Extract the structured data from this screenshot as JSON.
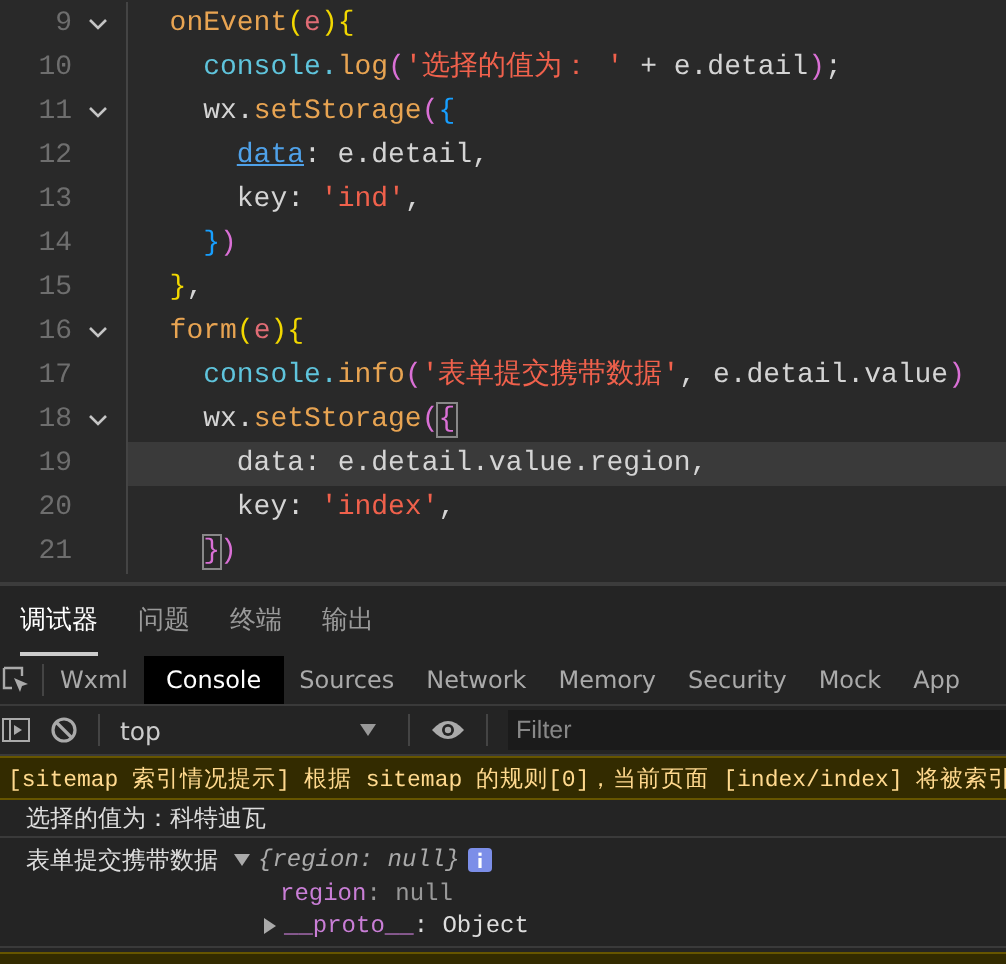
{
  "editor": {
    "lines": [
      {
        "number": "9",
        "foldable": true,
        "highlighted": false,
        "tokens": [
          {
            "text": "  onEvent",
            "kind": "fn"
          },
          {
            "text": "(",
            "kind": "br1"
          },
          {
            "text": "e",
            "kind": "param"
          },
          {
            "text": ")",
            "kind": "br1"
          },
          {
            "text": "{",
            "kind": "br1"
          }
        ]
      },
      {
        "number": "10",
        "foldable": false,
        "highlighted": false,
        "tokens": [
          {
            "text": "    console.",
            "kind": "obj"
          },
          {
            "text": "log",
            "kind": "fn"
          },
          {
            "text": "(",
            "kind": "br2"
          },
          {
            "text": "'选择的值为： '",
            "kind": "str"
          },
          {
            "text": " + e.detail",
            "kind": "txt"
          },
          {
            "text": ")",
            "kind": "br2"
          },
          {
            "text": ";",
            "kind": "txt"
          }
        ]
      },
      {
        "number": "11",
        "foldable": true,
        "highlighted": false,
        "tokens": [
          {
            "text": "    wx.",
            "kind": "txt"
          },
          {
            "text": "setStorage",
            "kind": "fn"
          },
          {
            "text": "(",
            "kind": "br2"
          },
          {
            "text": "{",
            "kind": "br3"
          }
        ]
      },
      {
        "number": "12",
        "foldable": false,
        "highlighted": false,
        "tokens": [
          {
            "text": "data",
            "kind": "link"
          },
          {
            "text": ": e.detail,",
            "kind": "txt"
          }
        ]
      },
      {
        "number": "13",
        "foldable": false,
        "highlighted": false,
        "tokens": [
          {
            "text": "      key: ",
            "kind": "txt"
          },
          {
            "text": "'ind'",
            "kind": "str"
          },
          {
            "text": ",",
            "kind": "txt"
          }
        ]
      },
      {
        "number": "14",
        "foldable": false,
        "highlighted": false,
        "tokens": [
          {
            "text": "    }",
            "kind": "br3"
          },
          {
            "text": ")",
            "kind": "br2"
          }
        ]
      },
      {
        "number": "15",
        "foldable": false,
        "highlighted": false,
        "tokens": [
          {
            "text": "  }",
            "kind": "br1"
          },
          {
            "text": ",",
            "kind": "txt"
          }
        ]
      },
      {
        "number": "16",
        "foldable": true,
        "highlighted": false,
        "tokens": [
          {
            "text": "  form",
            "kind": "fn"
          },
          {
            "text": "(",
            "kind": "br1"
          },
          {
            "text": "e",
            "kind": "param"
          },
          {
            "text": ")",
            "kind": "br1"
          },
          {
            "text": "{",
            "kind": "br1"
          }
        ]
      },
      {
        "number": "17",
        "foldable": false,
        "highlighted": false,
        "tokens": [
          {
            "text": "    console.",
            "kind": "obj"
          },
          {
            "text": "info",
            "kind": "fn"
          },
          {
            "text": "(",
            "kind": "br2"
          },
          {
            "text": "'表单提交携带数据'",
            "kind": "str"
          },
          {
            "text": ", e.detail.value",
            "kind": "txt"
          },
          {
            "text": ")",
            "kind": "br2"
          }
        ]
      },
      {
        "number": "18",
        "foldable": true,
        "highlighted": false,
        "tokens": [
          {
            "text": "    wx.",
            "kind": "txt"
          },
          {
            "text": "setStorage",
            "kind": "fn"
          },
          {
            "text": "(",
            "kind": "br2"
          },
          {
            "text": "{",
            "kind": "match"
          }
        ]
      },
      {
        "number": "19",
        "foldable": false,
        "highlighted": true,
        "tokens": [
          {
            "text": "      data: e.detail.value.region,",
            "kind": "txt"
          }
        ]
      },
      {
        "number": "20",
        "foldable": false,
        "highlighted": false,
        "tokens": [
          {
            "text": "      key: ",
            "kind": "txt"
          },
          {
            "text": "'index'",
            "kind": "str"
          },
          {
            "text": ",",
            "kind": "txt"
          }
        ]
      },
      {
        "number": "21",
        "foldable": false,
        "highlighted": false,
        "tokens": [
          {
            "text": "}",
            "kind": "match"
          },
          {
            "text": ")",
            "kind": "br2"
          }
        ]
      }
    ]
  },
  "panel_tabs": [
    {
      "label": "调试器",
      "selected": true
    },
    {
      "label": "问题",
      "selected": false
    },
    {
      "label": "终端",
      "selected": false
    },
    {
      "label": "输出",
      "selected": false
    }
  ],
  "devtools_tabs": [
    {
      "label": "Wxml",
      "selected": false
    },
    {
      "label": "Console",
      "selected": true
    },
    {
      "label": "Sources",
      "selected": false
    },
    {
      "label": "Network",
      "selected": false
    },
    {
      "label": "Memory",
      "selected": false
    },
    {
      "label": "Security",
      "selected": false
    },
    {
      "label": "Mock",
      "selected": false
    },
    {
      "label": "App",
      "selected": false
    }
  ],
  "toolbar": {
    "context": "top",
    "filter_placeholder": "Filter"
  },
  "messages": [
    {
      "kind": "warning",
      "text": "[sitemap 索引情况提示] 根据 sitemap 的规则[0]，当前页面 [index/index] 将被索引"
    },
    {
      "kind": "log",
      "text": "选择的值为：科特迪瓦"
    },
    {
      "kind": "object",
      "label": "表单提交携带数据",
      "preview": "{region: null}",
      "properties": [
        {
          "key": "region",
          "value": ": null"
        }
      ],
      "proto": {
        "key": "__proto__",
        "value": ": Object"
      }
    },
    {
      "kind": "warning_cut"
    }
  ]
}
